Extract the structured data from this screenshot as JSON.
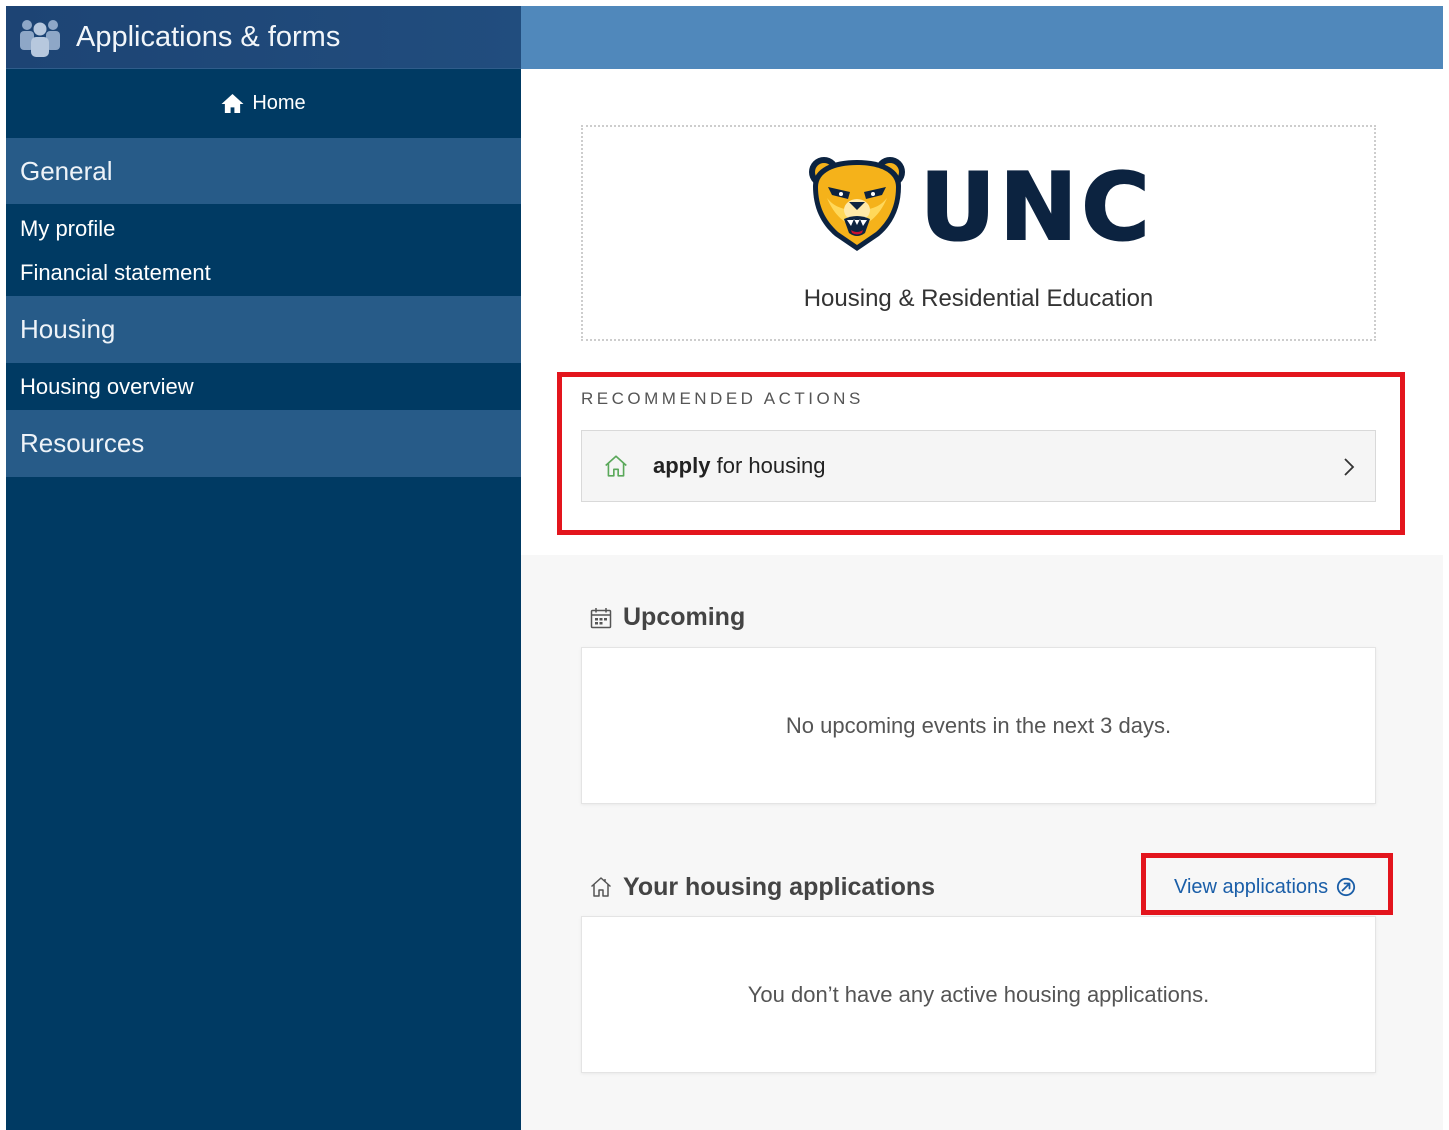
{
  "sidebar": {
    "title": "Applications & forms",
    "title_icon": "people-icon",
    "home": {
      "label": "Home",
      "icon": "home-icon"
    },
    "sections": [
      {
        "title": "General",
        "items": [
          "My profile",
          "Financial statement"
        ]
      },
      {
        "title": "Housing",
        "items": [
          "Housing overview"
        ]
      },
      {
        "title": "Resources",
        "items": []
      }
    ]
  },
  "branding": {
    "logo_icon": "bear-mascot-icon",
    "logo_text": "UNC",
    "subtitle": "Housing & Residential Education"
  },
  "recommended_actions": {
    "heading": "RECOMMENDED ACTIONS",
    "items": [
      {
        "verb": "apply",
        "label": "for housing",
        "icon": "house-icon",
        "trailing_icon": "chevron-right-icon"
      }
    ]
  },
  "upcoming": {
    "heading": "Upcoming",
    "icon": "calendar-icon",
    "empty_message": "No upcoming events in the next 3 days."
  },
  "housing_applications": {
    "heading": "Your housing applications",
    "icon": "house-outline-icon",
    "link_label": "View applications",
    "link_icon": "circle-arrow-icon",
    "empty_message": "You don’t have any active housing applications."
  },
  "colors": {
    "sidebar_bg": "#003a63",
    "sidebar_header_bg": "#1d4474",
    "section_bg": "#275b88",
    "topbar": "#5088bb",
    "content_bg": "#f7f7f7",
    "accent_link": "#1a5ea8",
    "annotation": "#e3151d",
    "logo_navy": "#0c2340",
    "logo_gold": "#f5b21a",
    "action_icon": "#5aa85a"
  }
}
